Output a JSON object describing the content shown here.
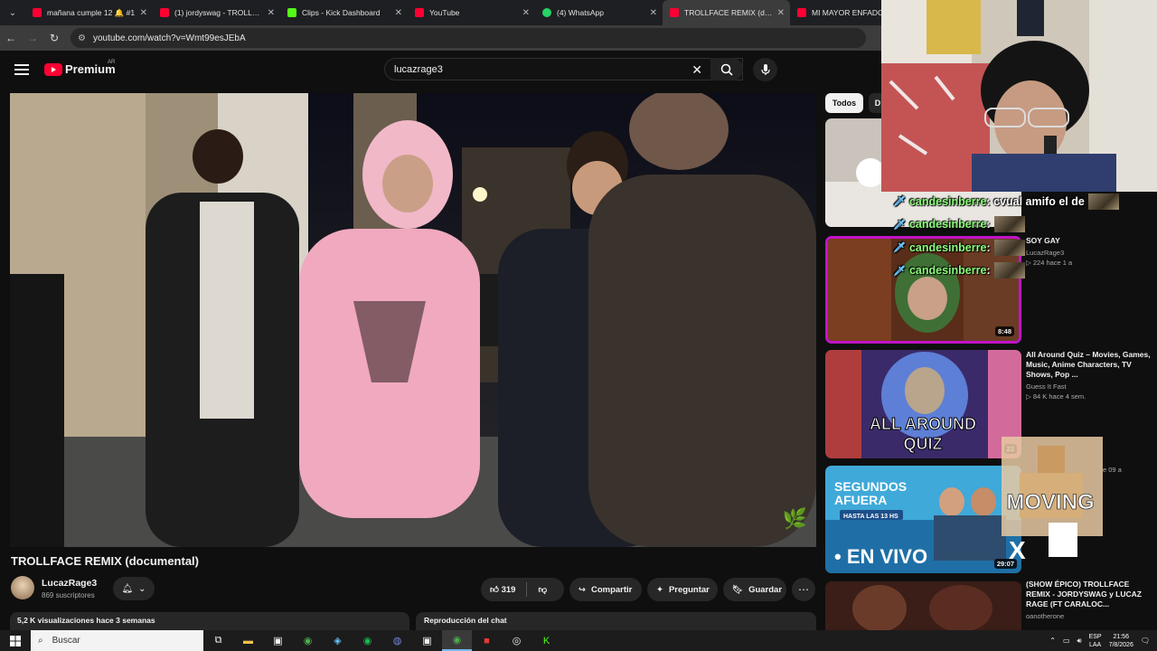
{
  "browser": {
    "tabs": [
      {
        "title": "mañana cumple 12 🔔 #1",
        "favicon_color": "#ff0033"
      },
      {
        "title": "(1) jordyswag - TROLLFACE",
        "favicon_color": "#ff0033"
      },
      {
        "title": "Clips - Kick Dashboard",
        "favicon_color": "#53fc18"
      },
      {
        "title": "YouTube",
        "favicon_color": "#ff0033"
      },
      {
        "title": "(4) WhatsApp",
        "favicon_color": "#25d366"
      },
      {
        "title": "TROLLFACE REMIX (docum",
        "favicon_color": "#ff0033"
      },
      {
        "title": "MI MAYOR ENFADO E",
        "favicon_color": "#ff0033"
      }
    ],
    "active_tab_index": 5,
    "url": "youtube.com/watch?v=Wmt99esJEbA"
  },
  "youtube": {
    "brand": "Premium",
    "region": "AR",
    "search_value": "lucazrage3",
    "video": {
      "title": "TROLLFACE REMIX (documental)",
      "channel": "LucazRage3",
      "subscribers": "869 suscriptores",
      "likes": "319",
      "share_label": "Compartir",
      "ask_label": "Preguntar",
      "save_label": "Guardar",
      "description_summary": "5,2 K visualizaciones  hace 3 semanas",
      "chat_replay": "Reproducción del chat"
    },
    "chips": [
      "Todos",
      "D"
    ],
    "recommendations": [
      {
        "title": "",
        "channel": "",
        "meta": "",
        "duration": ""
      },
      {
        "title": "SOY GAY",
        "channel": "LucazRage3",
        "meta": "▷ 224  hace 1 a",
        "duration": "8:48"
      },
      {
        "title": "All Around Quiz – Movies, Games, Music, Anime Characters, TV Shows, Pop ...",
        "channel": "Guess It Fast",
        "meta": "▷ 84 K  hace 4 sem.",
        "duration": "22",
        "thumb_text": "ALL AROUND QUIZ"
      },
      {
        "title": "",
        "channel": "",
        "meta": "e 09 a",
        "duration": "29:07",
        "thumb_text_top": "SEGUNDOS AFUERA",
        "thumb_text_sub": "HASTA LAS 13 HS",
        "thumb_text_bottom": "• EN VIVO"
      },
      {
        "title": "(SHOW ÉPICO) TROLLFACE REMIX - JORDYSWAG y LUCAZ RAGE (FT CARALOC...",
        "channel": "oanotherone",
        "meta": "",
        "duration": ""
      }
    ]
  },
  "stream_chat": [
    {
      "user": "candesinberre",
      "text": "cvual amifo el de"
    },
    {
      "user": "candesinberre",
      "text": ""
    },
    {
      "user": "candesinberre",
      "text": ""
    },
    {
      "user": "candesinberre",
      "text": ""
    }
  ],
  "alert_text": "MOVING",
  "taskbar": {
    "search_placeholder": "Buscar",
    "language": "ESP",
    "layout": "LAA",
    "time": "21:56",
    "date": "7/8/2026"
  },
  "colors": {
    "youtube_red": "#ff0033",
    "chat_username": "#8dff7a",
    "highlight_border": "#c113c7"
  }
}
